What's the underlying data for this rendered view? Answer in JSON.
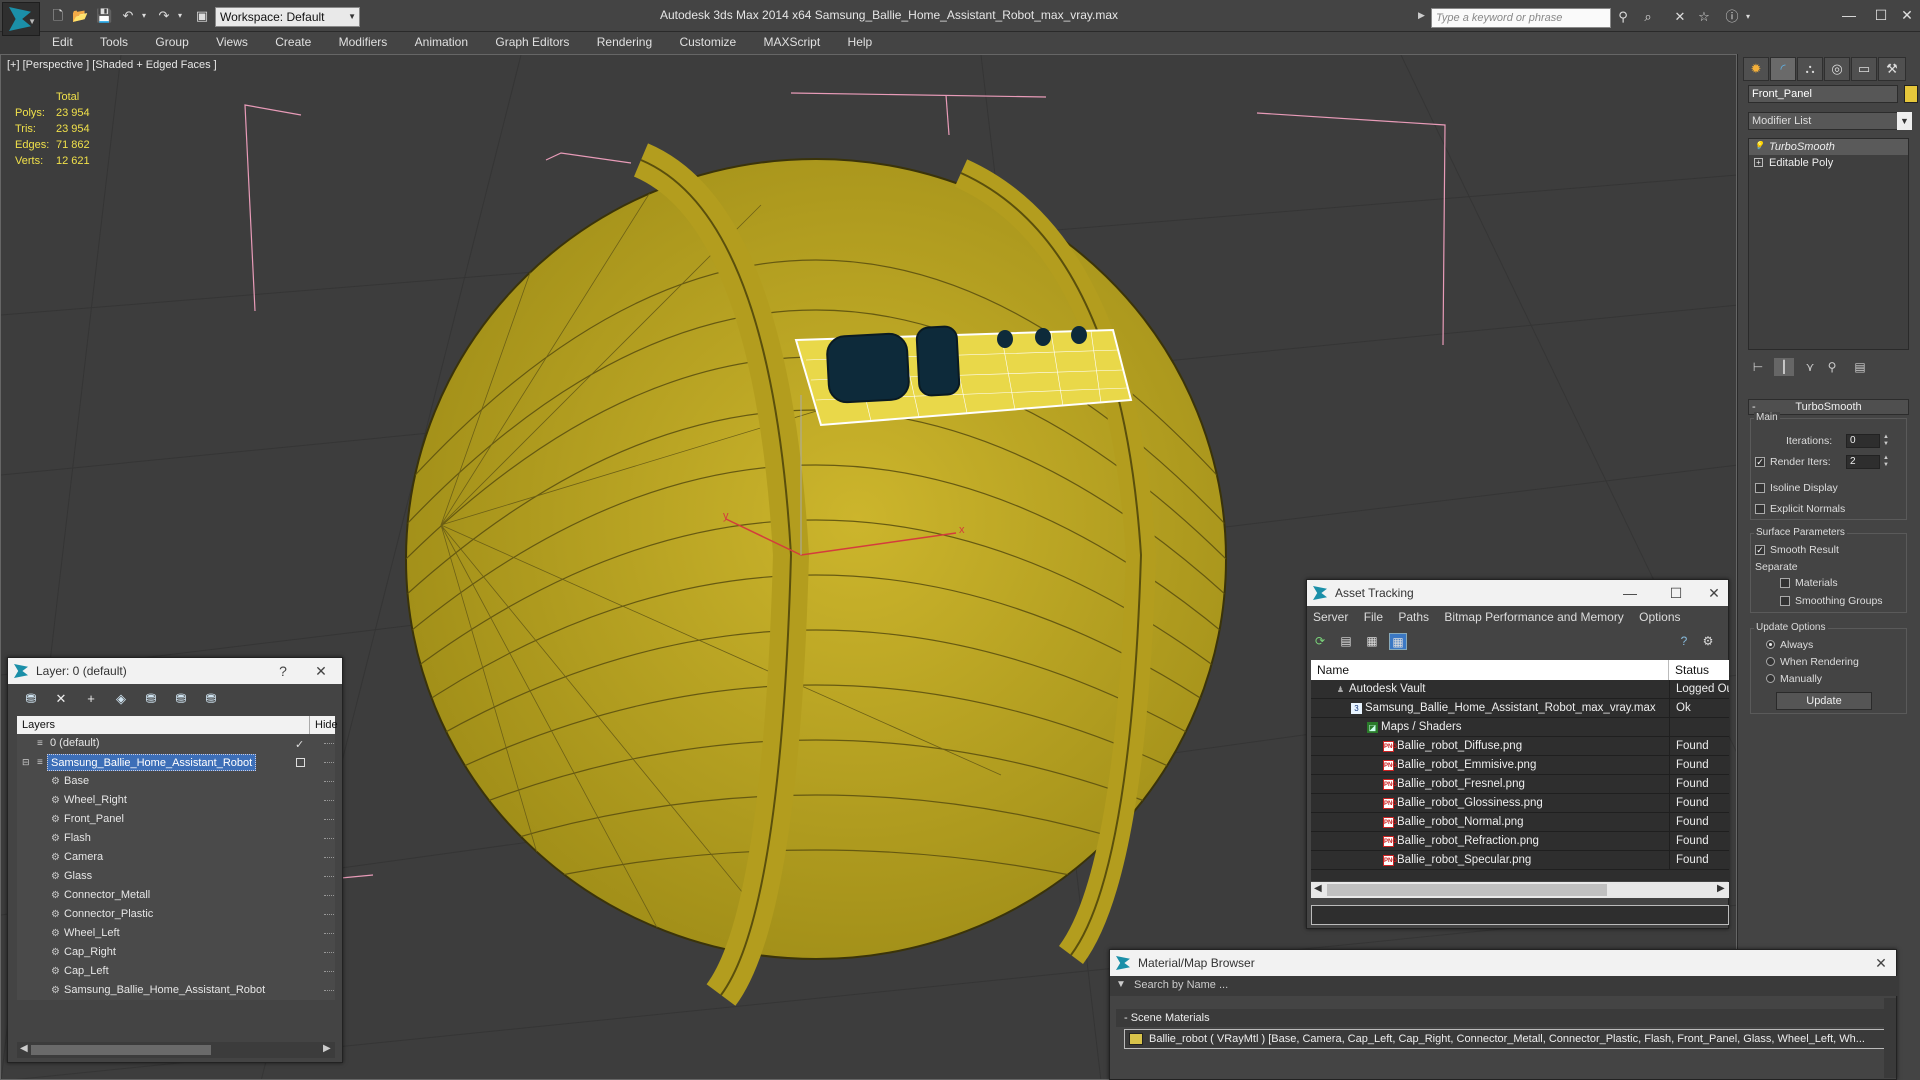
{
  "titlebar": {
    "workspace": "Workspace: Default",
    "title": "Autodesk 3ds Max  2014 x64      Samsung_Ballie_Home_Assistant_Robot_max_vray.max",
    "search_placeholder": "Type a keyword or phrase"
  },
  "menu": [
    "Edit",
    "Tools",
    "Group",
    "Views",
    "Create",
    "Modifiers",
    "Animation",
    "Graph Editors",
    "Rendering",
    "Customize",
    "MAXScript",
    "Help"
  ],
  "viewport": {
    "label": "[+] [Perspective ] [Shaded + Edged Faces ]",
    "stats": {
      "header": "Total",
      "rows": [
        {
          "label": "Polys:",
          "value": "23 954"
        },
        {
          "label": "Tris:",
          "value": "23 954"
        },
        {
          "label": "Edges:",
          "value": "71 862"
        },
        {
          "label": "Verts:",
          "value": "12 621"
        }
      ]
    },
    "axis_x": "x",
    "axis_y": "y"
  },
  "command_panel": {
    "object_name": "Front_Panel",
    "object_color": "#e6c73b",
    "modifier_list": "Modifier List",
    "stack": [
      "TurboSmooth",
      "Editable Poly"
    ],
    "rollout_title": "TurboSmooth",
    "main_label": "Main",
    "iterations_label": "Iterations:",
    "iterations_value": "0",
    "render_iters_label": "Render Iters:",
    "render_iters_value": "2",
    "isoline_label": "Isoline Display",
    "explicit_normals_label": "Explicit Normals",
    "surface_params_label": "Surface Parameters",
    "smooth_result_label": "Smooth Result",
    "separate_label": "Separate",
    "materials_label": "Materials",
    "smoothing_groups_label": "Smoothing Groups",
    "update_options_label": "Update Options",
    "always_label": "Always",
    "when_rendering_label": "When Rendering",
    "manually_label": "Manually",
    "update_button": "Update"
  },
  "layer_window": {
    "title": "Layer: 0 (default)",
    "help": "?",
    "col_layers": "Layers",
    "col_hide": "Hide",
    "rows": [
      {
        "name": "0 (default)",
        "level": 0
      },
      {
        "name": "Samsung_Ballie_Home_Assistant_Robot",
        "level": 0
      },
      {
        "name": "Base",
        "level": 1
      },
      {
        "name": "Wheel_Right",
        "level": 1
      },
      {
        "name": "Front_Panel",
        "level": 1
      },
      {
        "name": "Flash",
        "level": 1
      },
      {
        "name": "Camera",
        "level": 1
      },
      {
        "name": "Glass",
        "level": 1
      },
      {
        "name": "Connector_Metall",
        "level": 1
      },
      {
        "name": "Connector_Plastic",
        "level": 1
      },
      {
        "name": "Wheel_Left",
        "level": 1
      },
      {
        "name": "Cap_Right",
        "level": 1
      },
      {
        "name": "Cap_Left",
        "level": 1
      },
      {
        "name": "Samsung_Ballie_Home_Assistant_Robot",
        "level": 1
      }
    ]
  },
  "asset_tracking": {
    "title": "Asset Tracking",
    "menu": [
      "Server",
      "File",
      "Paths",
      "Bitmap Performance and Memory",
      "Options"
    ],
    "col_name": "Name",
    "col_status": "Status",
    "rows": [
      {
        "name": "Autodesk Vault",
        "status": "Logged Out",
        "level": 0
      },
      {
        "name": "Samsung_Ballie_Home_Assistant_Robot_max_vray.max",
        "status": "Ok",
        "level": 1
      },
      {
        "name": "Maps / Shaders",
        "status": "",
        "level": 2
      },
      {
        "name": "Ballie_robot_Diffuse.png",
        "status": "Found",
        "level": 3
      },
      {
        "name": "Ballie_robot_Emmisive.png",
        "status": "Found",
        "level": 3
      },
      {
        "name": "Ballie_robot_Fresnel.png",
        "status": "Found",
        "level": 3
      },
      {
        "name": "Ballie_robot_Glossiness.png",
        "status": "Found",
        "level": 3
      },
      {
        "name": "Ballie_robot_Normal.png",
        "status": "Found",
        "level": 3
      },
      {
        "name": "Ballie_robot_Refraction.png",
        "status": "Found",
        "level": 3
      },
      {
        "name": "Ballie_robot_Specular.png",
        "status": "Found",
        "level": 3
      }
    ]
  },
  "material_browser": {
    "title": "Material/Map Browser",
    "search_placeholder": "Search by Name ...",
    "group": "- Scene Materials",
    "material": "Ballie_robot ( VRayMtl ) [Base, Camera, Cap_Left, Cap_Right, Connector_Metall, Connector_Plastic, Flash, Front_Panel, Glass, Wheel_Left, Wh..."
  }
}
